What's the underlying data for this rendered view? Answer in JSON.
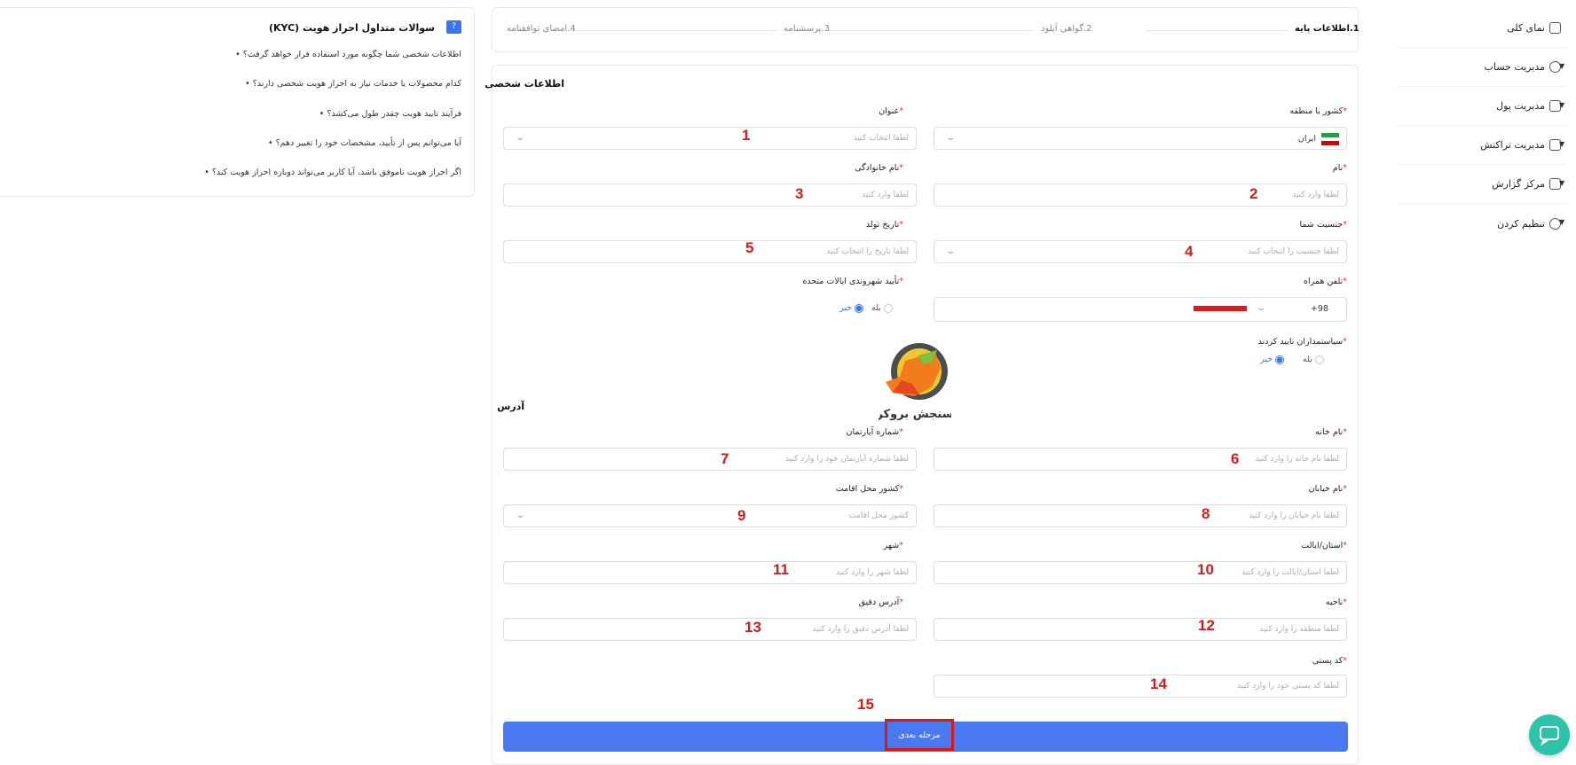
{
  "sidebar": {
    "items": [
      {
        "label": "نمای کلی",
        "icon": "dashboard-icon"
      },
      {
        "label": "مدیریت حساب",
        "icon": "account-icon"
      },
      {
        "label": "مدیریت پول",
        "icon": "wallet-icon"
      },
      {
        "label": "مدیریت تراکنش",
        "icon": "transaction-icon"
      },
      {
        "label": "مرکز گزارش",
        "icon": "report-icon"
      },
      {
        "label": "تنظیم کردن",
        "icon": "settings-icon"
      }
    ]
  },
  "stepper": {
    "steps": [
      "1.اطلاعات پایه",
      "2.گواهی آپلود",
      "3.پرسشنامه",
      "4.امضای توافقنامه"
    ],
    "active_index": 0
  },
  "form": {
    "personal_title": "اطلاعات شخصی",
    "address_title": "آدرس",
    "country": {
      "label": "کشور یا منطقه",
      "value": "ایران"
    },
    "title_field": {
      "label": "عنوان",
      "placeholder": "لطفا انتخاب کنید"
    },
    "first_name": {
      "label": "نام",
      "placeholder": "لطفا وارد کنید"
    },
    "last_name": {
      "label": "نام خانوادگی",
      "placeholder": "لطفا وارد کنید"
    },
    "gender": {
      "label": "جنسیت شما",
      "placeholder": "لطفا جنسیت را انتخاب کنید"
    },
    "birth_date": {
      "label": "تاریخ تولد",
      "placeholder": "لطفا تاریخ را انتخاب کنید"
    },
    "phone": {
      "label": "تلفن همراه",
      "code": "+98"
    },
    "us_citizen": {
      "label": "تأیید شهروندی ایالات متحده",
      "yes": "بله",
      "no": "خیر",
      "selected": "no"
    },
    "politician": {
      "label": "سیاستمداران تایید کردند",
      "yes": "بله",
      "no": "خیر",
      "selected": "no"
    },
    "house_name": {
      "label": "نام خانه",
      "placeholder": "لطفا نام خانه را وارد کنید"
    },
    "apartment_number": {
      "label": "شماره آپارتمان",
      "placeholder": "لطفا شماره آپارتمان خود را وارد کنید"
    },
    "street": {
      "label": "نام خیابان",
      "placeholder": "لطفا نام خیابان را وارد کنید"
    },
    "residence_country": {
      "label": "کشور محل اقامت",
      "placeholder": "کشور محل اقامت"
    },
    "province": {
      "label": "استان/ایالت",
      "placeholder": "لطفا استان/ایالت را وارد کنید"
    },
    "city": {
      "label": "شهر",
      "placeholder": "لطفا شهر را وارد کنید"
    },
    "district": {
      "label": "ناحیه",
      "placeholder": "لطفا منطقه را وارد کنید"
    },
    "exact_address": {
      "label": "آدرس دقیق",
      "placeholder": "لطفا آدرس دقیق را وارد کنید"
    },
    "postal_code": {
      "label": "کد پستی",
      "placeholder": "لطفا کد پستی خود را وارد کنید"
    },
    "next_button": "مرحله بعدی",
    "required_mark": "*"
  },
  "annotations": [
    "1",
    "2",
    "3",
    "4",
    "5",
    "6",
    "7",
    "8",
    "9",
    "10",
    "11",
    "12",
    "13",
    "14",
    "15"
  ],
  "logo_text": "سنجش بروکر",
  "faq": {
    "title": "سوالات متداول احراز هویت (KYC)",
    "questions": [
      "اطلاعات شخصی شما چگونه مورد استفاده قرار خواهد گرفت؟ •",
      "کدام محصولات یا خدمات نیاز به احراز هویت شخصی دارند؟ •",
      "فرآیند تایید هویت چقدر طول می‌کشد؟ •",
      "آیا می‌توانم پس از تأیید، مشخصات خود را تغییر دهم؟ •",
      "اگر احراز هویت ناموفق باشد، آیا کاربر می‌تواند دوباره احراز هویت کند؟ •"
    ]
  },
  "colors": {
    "primary": "#4a78f0",
    "annotation": "#d61a1a",
    "chat": "#2dc3a9"
  }
}
